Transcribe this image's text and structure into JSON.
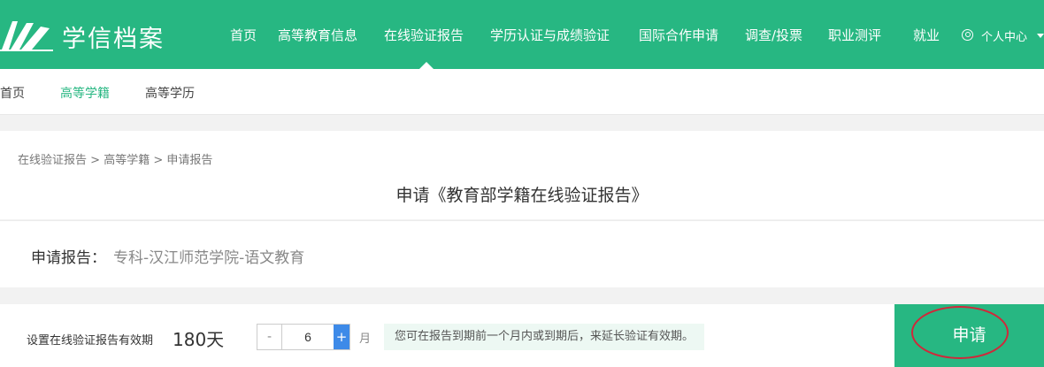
{
  "header": {
    "logo_text": "学信档案",
    "nav": [
      "首页",
      "高等教育信息",
      "在线验证报告",
      "学历认证与成绩验证",
      "国际合作申请",
      "调查/投票",
      "职业测评",
      "就业"
    ],
    "user_menu": "个人中心"
  },
  "subnav": {
    "items": [
      "首页",
      "高等学籍",
      "高等学历"
    ],
    "active_index": 1
  },
  "breadcrumb": [
    "在线验证报告",
    "高等学籍",
    "申请报告"
  ],
  "breadcrumb_sep": " > ",
  "page_title": "申请《教育部学籍在线验证报告》",
  "report": {
    "label": "申请报告：",
    "value": "专科-汉江师范学院-语文教育"
  },
  "validity": {
    "label": "设置在线验证报告有效期",
    "days": "180天",
    "stepper_value": "6",
    "minus": "-",
    "plus": "+",
    "unit": "月",
    "hint": "您可在报告到期前一个月内或到期后，来延长验证有效期。"
  },
  "apply_button": "申请",
  "colors": {
    "brand_green": "#27b782",
    "stepper_blue": "#3d8ae8",
    "annotation_red": "#d0283a"
  }
}
